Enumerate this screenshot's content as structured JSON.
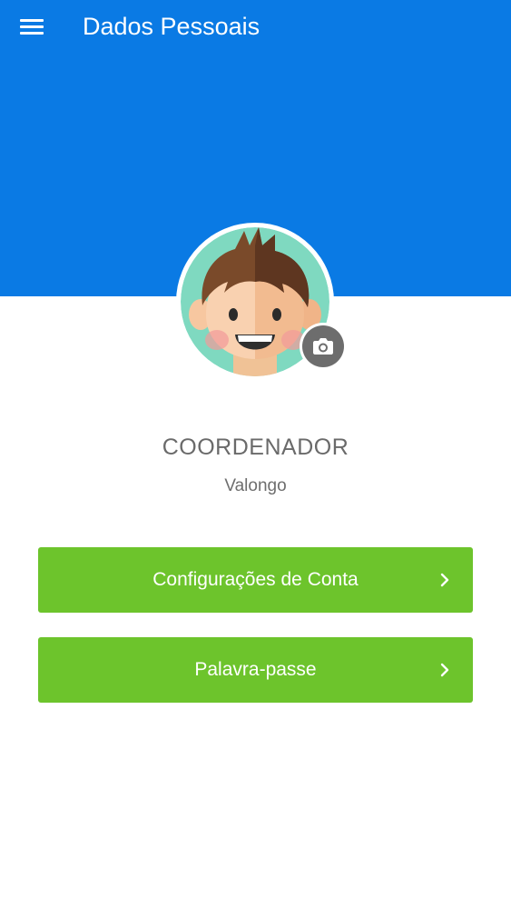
{
  "header": {
    "title": "Dados Pessoais",
    "menu_icon": "hamburger-menu-icon",
    "background_color": "#0a7ae4"
  },
  "profile": {
    "avatar_icon": "boy-avatar",
    "camera_icon": "camera-icon",
    "role": "COORDENADOR",
    "location": "Valongo"
  },
  "actions": [
    {
      "label": "Configurações de Conta",
      "icon": "chevron-right-icon"
    },
    {
      "label": "Palavra-passe",
      "icon": "chevron-right-icon"
    }
  ],
  "colors": {
    "accent_green": "#6dc42c",
    "avatar_ring": "#7fd9c0",
    "camera_badge": "#6d6d6d"
  }
}
